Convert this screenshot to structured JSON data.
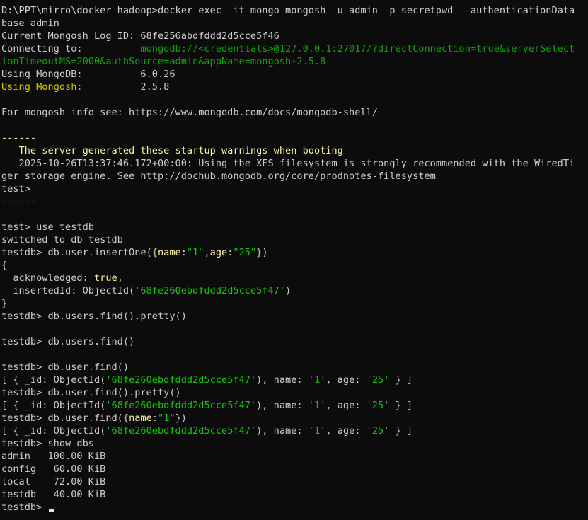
{
  "theme": {
    "background": "#0c0c0c",
    "foreground": "#cccccc",
    "yellow": "#f9f1a5",
    "warm_yellow": "#d7c700",
    "green": "#16c60c",
    "cursor": "#e5e5e5"
  },
  "lines": [
    [
      {
        "t": "D:\\PPT\\mirro\\docker-hadoop>docker exec -it mongo mongosh -u admin -p secretpwd --authenticationData"
      }
    ],
    [
      {
        "t": "base admin"
      }
    ],
    [
      {
        "t": "Current Mongosh Log ID: 68fe256abdfddd2d5cce5f46"
      }
    ],
    [
      {
        "t": "Connecting to:          "
      },
      {
        "t": "mongodb://<credentials>@127.0.0.1:27017/?directConnection=true&serverSelect",
        "c": "gt"
      }
    ],
    [
      {
        "t": "ionTimeoutMS=2000&authSource=admin&appName=mongosh+2.5.8",
        "c": "gt"
      }
    ],
    [
      {
        "t": "Using MongoDB:          6.0.26"
      }
    ],
    [
      {
        "t": "Using Mongosh:",
        "c": "dy"
      },
      {
        "t": "          2.5.8"
      }
    ],
    [],
    [
      {
        "t": "For mongosh info see: https://www.mongodb.com/docs/mongodb-shell/"
      }
    ],
    [],
    [
      {
        "t": "------",
        "c": "y"
      }
    ],
    [
      {
        "t": "   The server generated these startup warnings when booting",
        "c": "y"
      }
    ],
    [
      {
        "t": "   2025-10-26T13:37:46.172+00:00: Using the XFS filesystem is strongly recommended with the WiredTi"
      }
    ],
    [
      {
        "t": "ger storage engine. See http://dochub.mongodb.org/core/prodnotes-filesystem"
      }
    ],
    [
      {
        "t": "test>"
      }
    ],
    [
      {
        "t": "------",
        "c": "y"
      }
    ],
    [],
    [
      {
        "t": "test> use testdb"
      }
    ],
    [
      {
        "t": "switched to db testdb"
      }
    ],
    [
      {
        "t": "testdb> db.user.insertOne({"
      },
      {
        "t": "name",
        "c": "y"
      },
      {
        "t": ":"
      },
      {
        "t": "\"1\"",
        "c": "g"
      },
      {
        "t": ","
      },
      {
        "t": "age",
        "c": "y"
      },
      {
        "t": ":"
      },
      {
        "t": "\"25\"",
        "c": "g"
      },
      {
        "t": "})"
      }
    ],
    [
      {
        "t": "{"
      }
    ],
    [
      {
        "t": "  acknowledged: "
      },
      {
        "t": "true",
        "c": "y"
      },
      {
        "t": ","
      }
    ],
    [
      {
        "t": "  insertedId: ObjectId("
      },
      {
        "t": "'68fe260ebdfddd2d5cce5f47'",
        "c": "g"
      },
      {
        "t": ")"
      }
    ],
    [
      {
        "t": "}"
      }
    ],
    [
      {
        "t": "testdb> db.users.find().pretty()"
      }
    ],
    [],
    [
      {
        "t": "testdb> db.users.find()"
      }
    ],
    [],
    [
      {
        "t": "testdb> db.user.find()"
      }
    ],
    [
      {
        "t": "[ { _id: ObjectId("
      },
      {
        "t": "'68fe260ebdfddd2d5cce5f47'",
        "c": "g"
      },
      {
        "t": "), name: "
      },
      {
        "t": "'1'",
        "c": "g"
      },
      {
        "t": ", age: "
      },
      {
        "t": "'25'",
        "c": "g"
      },
      {
        "t": " } ]"
      }
    ],
    [
      {
        "t": "testdb> db.user.find().pretty()"
      }
    ],
    [
      {
        "t": "[ { _id: ObjectId("
      },
      {
        "t": "'68fe260ebdfddd2d5cce5f47'",
        "c": "g"
      },
      {
        "t": "), name: "
      },
      {
        "t": "'1'",
        "c": "g"
      },
      {
        "t": ", age: "
      },
      {
        "t": "'25'",
        "c": "g"
      },
      {
        "t": " } ]"
      }
    ],
    [
      {
        "t": "testdb> db.user.find({"
      },
      {
        "t": "name",
        "c": "y"
      },
      {
        "t": ":"
      },
      {
        "t": "\"1\"",
        "c": "g"
      },
      {
        "t": "})"
      }
    ],
    [
      {
        "t": "[ { _id: ObjectId("
      },
      {
        "t": "'68fe260ebdfddd2d5cce5f47'",
        "c": "g"
      },
      {
        "t": "), name: "
      },
      {
        "t": "'1'",
        "c": "g"
      },
      {
        "t": ", age: "
      },
      {
        "t": "'25'",
        "c": "g"
      },
      {
        "t": " } ]"
      }
    ],
    [
      {
        "t": "testdb> show dbs"
      }
    ],
    [
      {
        "t": "admin   100.00 KiB"
      }
    ],
    [
      {
        "t": "config   60.00 KiB"
      }
    ],
    [
      {
        "t": "local    72.00 KiB"
      }
    ],
    [
      {
        "t": "testdb   40.00 KiB"
      }
    ],
    [
      {
        "t": "testdb> "
      }
    ]
  ],
  "cursor_visible": true
}
